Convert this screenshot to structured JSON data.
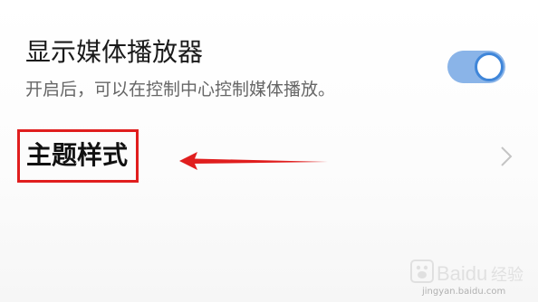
{
  "media_player_setting": {
    "title": "显示媒体播放器",
    "description": "开启后，可以在控制中心控制媒体播放。",
    "enabled": true
  },
  "theme_setting": {
    "label": "主题样式",
    "chevron_icon": "chevron-right-icon"
  },
  "annotation": {
    "box_color": "#e01e1e",
    "arrow_color": "#e01e1e"
  },
  "colors": {
    "toggle_track": "#8ab4e8",
    "toggle_knob_border": "#3f86d9"
  },
  "watermark": {
    "brand": "Baidu 经验",
    "url": "jingyan.baidu.com"
  }
}
